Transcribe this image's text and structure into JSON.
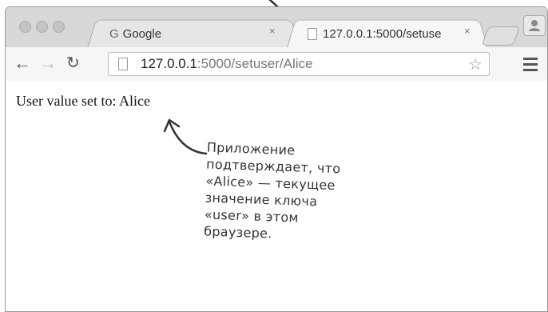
{
  "browser": {
    "tabs": [
      {
        "label": "Google",
        "icon": "google-icon",
        "close": "×"
      },
      {
        "label": "127.0.0.1:5000/setuse",
        "icon": "page-icon",
        "close": "×"
      }
    ],
    "url_host": "127.0.0.1",
    "url_path": ":5000/setuser/Alice"
  },
  "page": {
    "text": "User value set to: Alice"
  },
  "annotation": {
    "lines": [
      "Приложение",
      "подтверждает, что",
      "«Alice» — текущее",
      "значение ключа",
      "«user» в этом",
      "браузере."
    ]
  }
}
